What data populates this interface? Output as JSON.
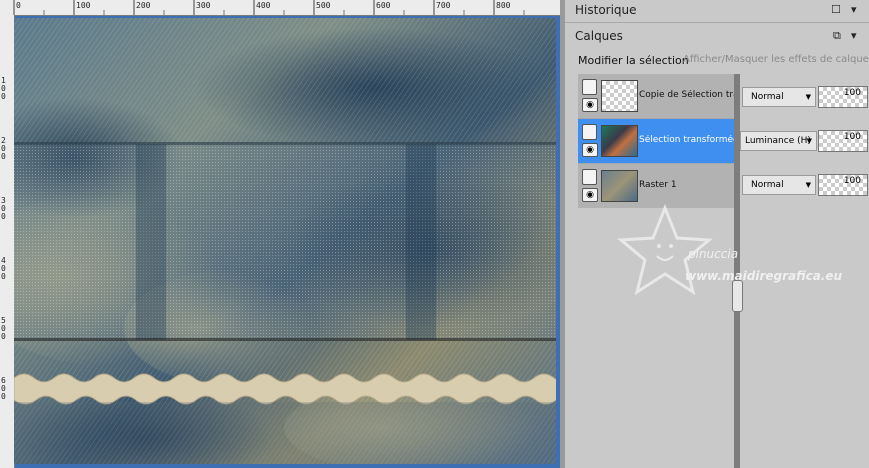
{
  "ruler": {
    "top_labels": [
      "0",
      "100",
      "200",
      "300",
      "400",
      "500",
      "600",
      "700",
      "800"
    ],
    "left_labels": [
      "1 0 0",
      "2 0 0",
      "3 0 0",
      "4 0 0",
      "5 0 0",
      "6 0 0"
    ]
  },
  "panels": {
    "history": {
      "title": "Historique"
    },
    "layers": {
      "title": "Calques",
      "modify_selection": "Modifier la sélection",
      "toggle_effects": "Afficher/Masquer les effets de calque",
      "items": [
        {
          "name": "Copie de Sélection tran",
          "blend": "Normal",
          "opacity": "100",
          "selected": false
        },
        {
          "name": "Sélection transformée",
          "blend": "Luminance (H)",
          "opacity": "100",
          "selected": true
        },
        {
          "name": "Raster 1",
          "blend": "Normal",
          "opacity": "100",
          "selected": false
        }
      ]
    }
  },
  "watermark": {
    "line1": "pinuccia",
    "line2": "www.maidiregrafica.eu"
  },
  "colors": {
    "selected_row": "#3e8ff0",
    "window_border": "#3c6fb3",
    "panel_bg": "#c9c9c9"
  }
}
